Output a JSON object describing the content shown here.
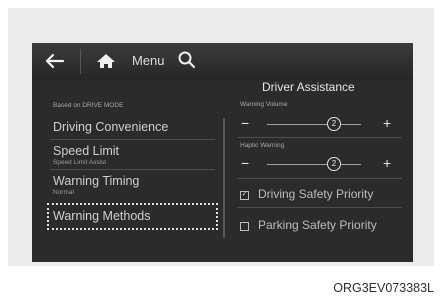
{
  "topbar": {
    "menu_label": "Menu",
    "icons": [
      "back-arrow-icon",
      "home-icon",
      "search-icon"
    ]
  },
  "section_title": "Driver Assistance",
  "sidebar": {
    "header": "Based on DRIVE MODE",
    "items": [
      {
        "label": "Driving Convenience",
        "sub": ""
      },
      {
        "label": "Speed Limit",
        "sub": "Speed Limit Assist"
      },
      {
        "label": "Warning Timing",
        "sub": "Normal"
      },
      {
        "label": "Warning Methods",
        "sub": "",
        "selected": true
      }
    ]
  },
  "settings": {
    "warning_volume": {
      "label": "Warning Volume",
      "value": "2",
      "minus": "−",
      "plus": "+"
    },
    "haptic_warning": {
      "label": "Haptic Warning",
      "value": "2",
      "minus": "−",
      "plus": "+"
    },
    "options": [
      {
        "label": "Driving Safety Priority",
        "checked": true
      },
      {
        "label": "Parking Safety Priority",
        "checked": false
      }
    ]
  },
  "caption": "ORG3EV073383L",
  "colors": {
    "screen_bg": "#2b2b2b",
    "frame_bg": "#ebebeb",
    "text": "#cfcfcf"
  }
}
